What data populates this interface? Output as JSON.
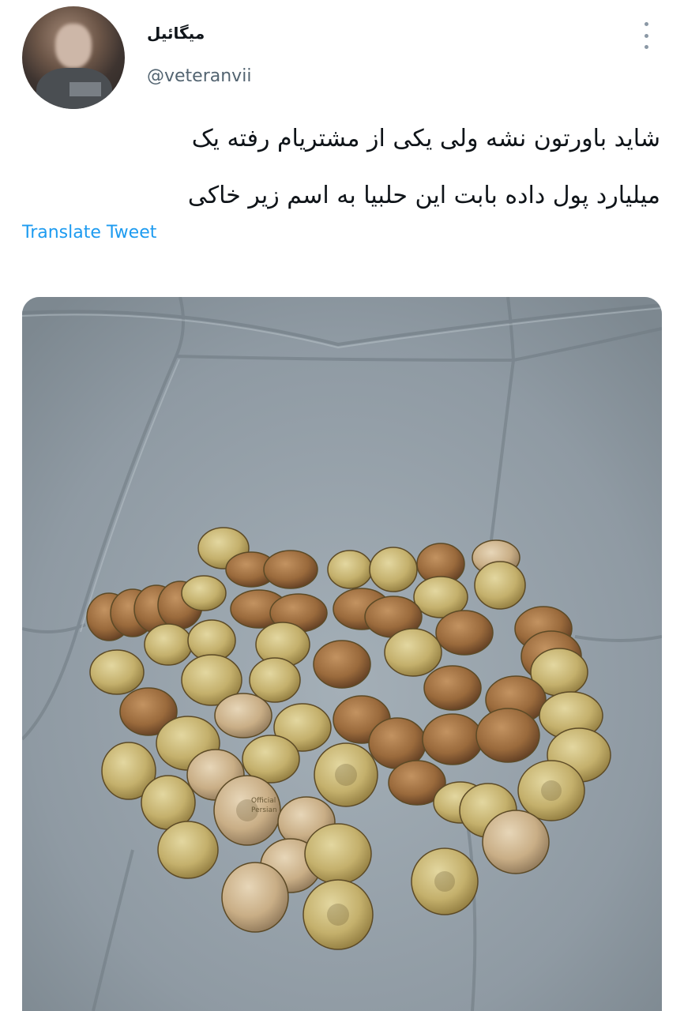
{
  "tweet": {
    "display_name": "میگائیل",
    "handle": "@veteranvii",
    "text_line1": "شاید باورتون نشه ولی یکی از مشتریام رفته یک",
    "text_line2": "میلیارد پول داده بابت این حلبیا به اسم زیر خاکی",
    "translate_label": "Translate Tweet",
    "more_icon": "more-vertical-icon",
    "watermark_line1": "Official",
    "watermark_line2": "Persian"
  },
  "colors": {
    "link": "#1d9bf0",
    "text": "#0f1419",
    "secondary": "#536471"
  }
}
